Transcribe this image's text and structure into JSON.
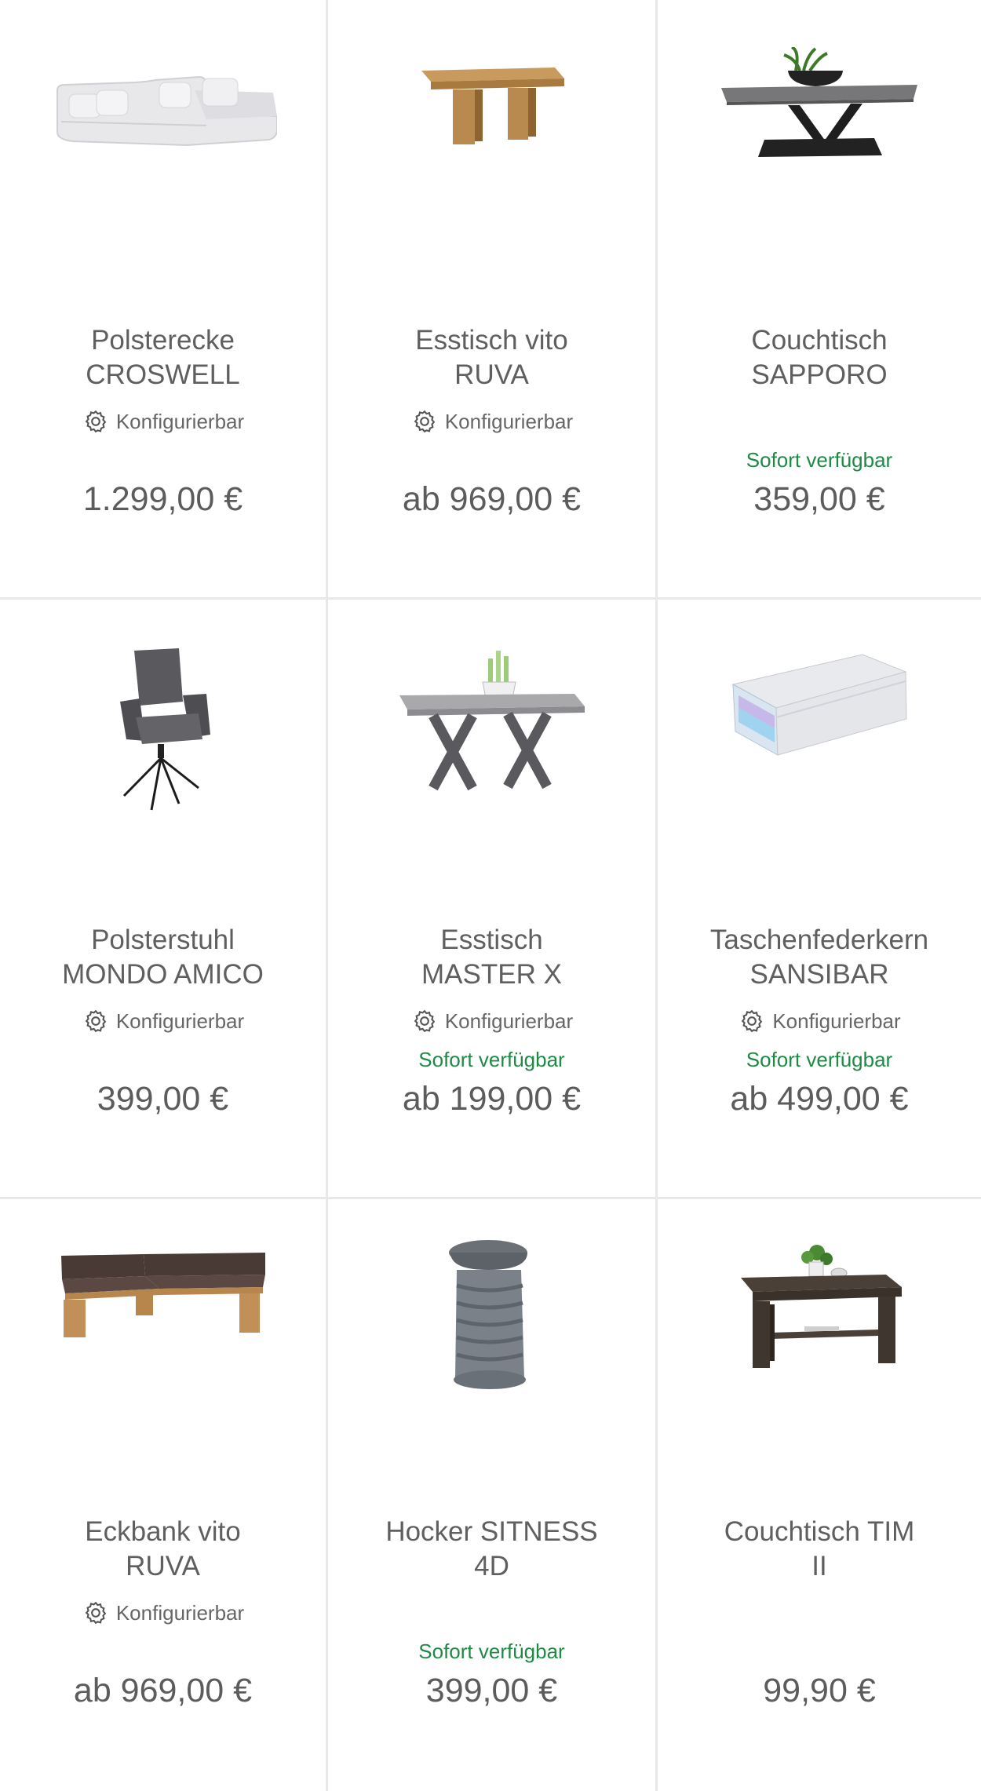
{
  "products": [
    {
      "title": "Polsterecke\nCROSWELL",
      "image_icon": "sofa-icon",
      "configurable": "Konfigurierbar",
      "availability": "",
      "price": "1.299,00 €"
    },
    {
      "title": "Esstisch vito\nRUVA",
      "image_icon": "table-icon",
      "configurable": "Konfigurierbar",
      "availability": "",
      "price": "ab 969,00 €"
    },
    {
      "title": "Couchtisch\nSAPPORO",
      "image_icon": "coffee-table-icon",
      "configurable": "",
      "availability": "Sofort verfügbar",
      "price": "359,00 €"
    },
    {
      "title": "Polsterstuhl\nMONDO AMICO",
      "image_icon": "chair-icon",
      "configurable": "Konfigurierbar",
      "availability": "",
      "price": "399,00 €"
    },
    {
      "title": "Esstisch\nMASTER X",
      "image_icon": "table-icon",
      "configurable": "Konfigurierbar",
      "availability": "Sofort verfügbar",
      "price": "ab 199,00 €"
    },
    {
      "title": "Taschenfederkern\nSANSIBAR",
      "image_icon": "mattress-icon",
      "configurable": "Konfigurierbar",
      "availability": "Sofort verfügbar",
      "price": "ab 499,00 €"
    },
    {
      "title": "Eckbank vito\nRUVA",
      "image_icon": "bench-icon",
      "configurable": "Konfigurierbar",
      "availability": "",
      "price": "ab 969,00 €"
    },
    {
      "title": "Hocker SITNESS\n4D",
      "image_icon": "stool-icon",
      "configurable": "",
      "availability": "Sofort verfügbar",
      "price": "399,00 €"
    },
    {
      "title": "Couchtisch TIM\nII",
      "image_icon": "coffee-table-icon",
      "configurable": "",
      "availability": "",
      "price": "99,90 €"
    }
  ],
  "colors": {
    "text": "#5f5f5f",
    "availability": "#1f8a45",
    "divider": "#e6e8ea"
  }
}
